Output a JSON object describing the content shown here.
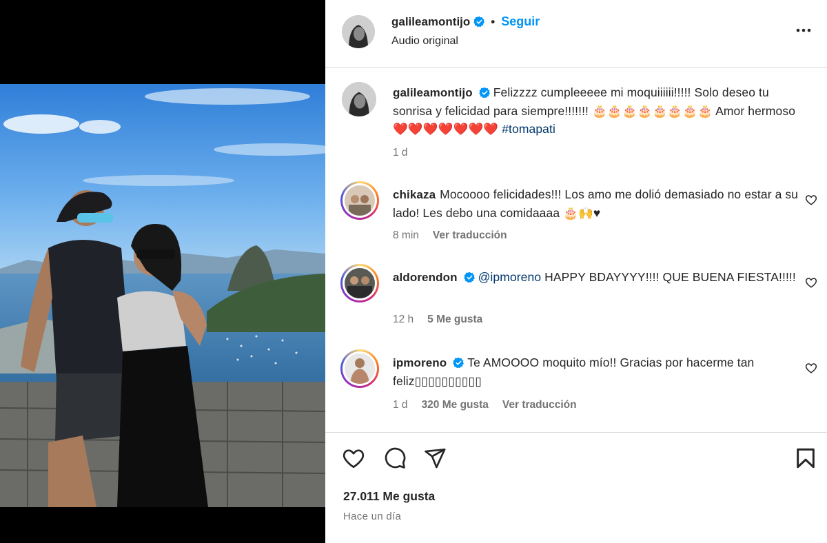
{
  "post": {
    "author": "galileamontijo",
    "follow_label": "Seguir",
    "separator": "•",
    "audio_label": "Audio original"
  },
  "caption": {
    "username": "galileamontijo",
    "text": "Felizzzz cumpleeeee mi moquiiiiii!!!!! Solo deseo tu sonrisa y felicidad para siempre!!!!!!! 🎂🎂🎂🎂🎂🎂🎂🎂 Amor hermoso❤️❤️❤️❤️❤️❤️❤️ ",
    "hashtag": "#tomapati",
    "time": "1 d"
  },
  "comments": [
    {
      "username": "chikaza",
      "verified": false,
      "mention": "",
      "text": "Mocoooo felicidades!!! Los amo me dolió demasiado no estar a su lado! Les debo una comidaaaa 🎂🙌♥",
      "time": "8 min",
      "likes": "",
      "translate": "Ver traducción"
    },
    {
      "username": "aldorendon",
      "verified": true,
      "mention": "@ipmoreno",
      "text": " HAPPY BDAYYYY!!!! QUE BUENA FIESTA!!!!!",
      "time": "12 h",
      "likes": "5 Me gusta",
      "translate": ""
    },
    {
      "username": "ipmoreno",
      "verified": true,
      "mention": "",
      "text": "Te AMOOOO moquito mío!! Gracias por hacerme tan feliz▯▯▯▯▯▯▯▯▯▯",
      "time": "1 d",
      "likes": "320 Me gusta",
      "translate": "Ver traducción"
    }
  ],
  "footer": {
    "likes": "27.011 Me gusta",
    "date": "Hace un día"
  },
  "icons": {
    "like": "heart-icon",
    "comment": "comment-icon",
    "share": "paper-plane-icon",
    "save": "bookmark-icon",
    "more": "more-options-icon",
    "verified": "verified-badge-icon"
  },
  "colors": {
    "accent": "#0095f6",
    "verified": "#0095f6",
    "link": "#00376b",
    "secondary_text": "#737373",
    "divider": "#dbdbdb"
  }
}
